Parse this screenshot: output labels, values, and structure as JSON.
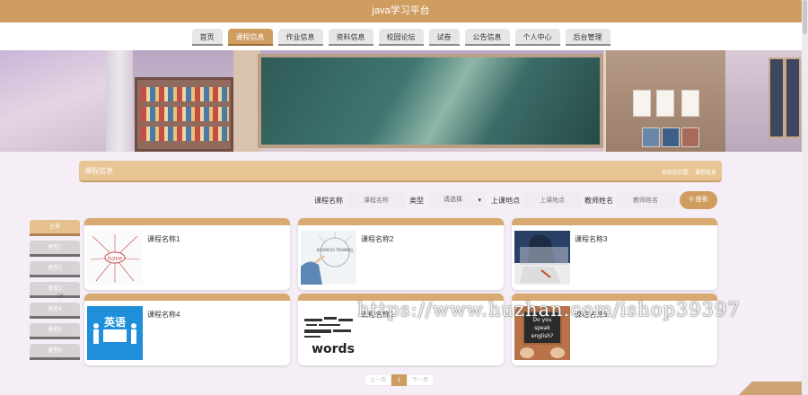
{
  "app": {
    "title": "java学习平台"
  },
  "nav": [
    "首页",
    "课程信息",
    "作业信息",
    "资料信息",
    "校园论坛",
    "试卷",
    "公告信息",
    "个人中心",
    "后台管理"
  ],
  "nav_active": 1,
  "section": {
    "title": "课程信息",
    "breadcrumb_prefix": "当前的位置:",
    "breadcrumb_current": "课程信息"
  },
  "search": {
    "name_label": "课程名称",
    "name_placeholder": "课程名称",
    "type_label": "类型",
    "type_value": "请选择",
    "place_label": "上课地点",
    "place_placeholder": "上课地点",
    "teacher_label": "教师姓名",
    "teacher_placeholder": "教师姓名",
    "button_label": "搜索"
  },
  "sidebar": [
    "全部",
    "类型1",
    "类型2",
    "类型3",
    "类型4",
    "类型5",
    "类型6"
  ],
  "sidebar_active": 0,
  "cards": [
    "课程名称1",
    "课程名称2",
    "课程名称3",
    "课程名称4",
    "课程名称5",
    "课程名称6"
  ],
  "card_images": {
    "c1_word": "have",
    "c2_word": "BUSINESS TRAINING",
    "c4_cn": "英语",
    "c5_word": "words",
    "c6_line1": "Do you",
    "c6_line2": "speak",
    "c6_line3": "english?"
  },
  "pager": {
    "prev": "上一页",
    "current": "1",
    "next": "下一页"
  },
  "watermark": "https://www.huzhan.com/ishop39397",
  "colors": {
    "accent": "#cf9d60",
    "header": "#e8c595"
  }
}
